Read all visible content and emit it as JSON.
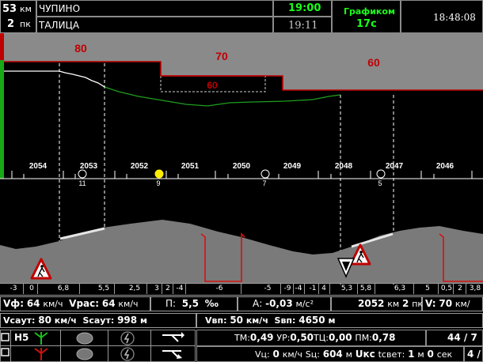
{
  "header": {
    "km_value": "53",
    "km_unit": "км",
    "pk_value": "2",
    "pk_unit": "пк",
    "station_current": "ЧУПИНО",
    "station_next": "ТАЛИЦА",
    "time_schedule": "19:00",
    "time_arrival": "19:11",
    "mode_label": "Графиком",
    "mode_value": "17с",
    "clock": "18:48:08"
  },
  "profile": {
    "speed_limits": [
      "80",
      "70",
      "60",
      "60"
    ],
    "km_labels": [
      "2054",
      "2053",
      "2052",
      "2051",
      "2050",
      "2049",
      "2048",
      "2047",
      "2046"
    ],
    "signal_labels": [
      "11",
      "9",
      "7",
      "5"
    ],
    "gradients": [
      "-3",
      "0",
      "6,8",
      "5,5",
      "2,5",
      "3",
      "2",
      "-4",
      "-6",
      "-5",
      "-9",
      "-4",
      "-1",
      "4",
      "5,3",
      "5,8",
      "6,3",
      "5",
      "0,5",
      "2",
      "3,8"
    ]
  },
  "row1": {
    "vf_label": "Vф:",
    "vf_value": "64",
    "vf_unit": "км/ч",
    "vrac_label": "Vрас:",
    "vrac_value": "64",
    "vrac_unit": "км/ч",
    "p_label": "П:",
    "p_value": "5,5",
    "p_unit": "‰",
    "a_label": "А:",
    "a_value": "-0,03",
    "a_unit": "м/с²",
    "pos_km": "2052",
    "pos_km_unit": "км",
    "pos_pk": "2",
    "pos_pk_unit": "пк",
    "v_label": "V:",
    "v_value": "70",
    "v_unit": "км/"
  },
  "row2": {
    "vsaut_label": "Vсаут:",
    "vsaut_value": "80",
    "vsaut_unit": "км/ч",
    "ssaut_label": "Sсаут:",
    "ssaut_value": "998",
    "ssaut_unit": "м",
    "vvp_label": "Vвп:",
    "vvp_value": "50",
    "vvp_unit": "км/ч",
    "svp_label": "Sвп:",
    "svp_value": "4650",
    "svp_unit": "м"
  },
  "row3": {
    "signal_code": "Н5",
    "tm_label": "ТМ:",
    "tm_value": "0,49",
    "ur_label": "УР:",
    "ur_value": "0,50",
    "tc_label": "ТЦ:",
    "tc_value": "0,00",
    "pm_label": "ПМ:",
    "pm_value": "0,78",
    "page": "44 / 7"
  },
  "row4": {
    "vc_label": "Vц:",
    "vc_value": "0",
    "vc_unit": "км/ч",
    "sc_label": "Sц:",
    "sc_value": "604",
    "sc_unit": "м",
    "ukc_label": "Uкс",
    "tsvet_label": "tсвет:",
    "tsvet_min": "1",
    "tsvet_min_unit": "м",
    "tsvet_sec": "0",
    "tsvet_sec_unit": "сек",
    "page_tail": "4 /"
  },
  "colors": {
    "speed_limit": "#c00000",
    "green_text": "#19ff19",
    "profile_fill": "#7a7a7a",
    "target_curve": "#1e9e1e"
  }
}
